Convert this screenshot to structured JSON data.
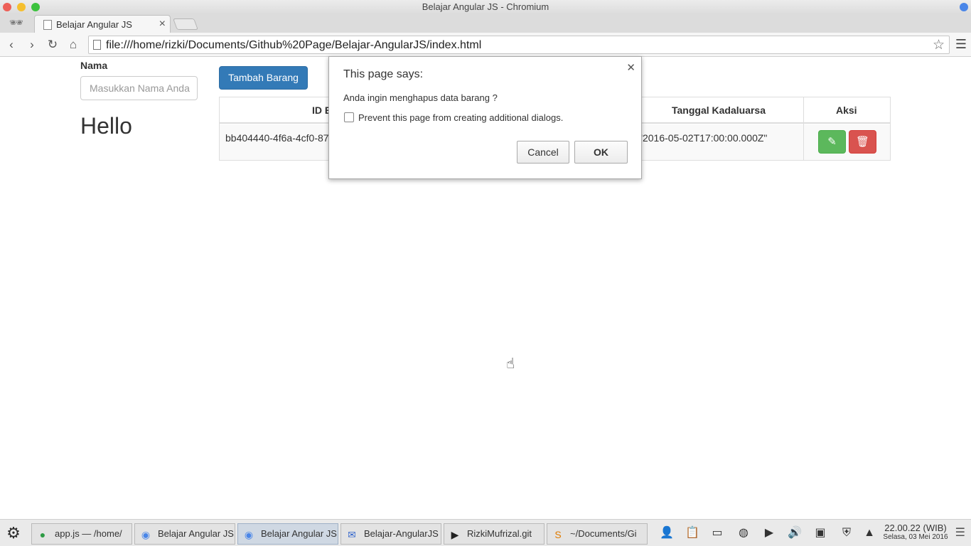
{
  "window": {
    "title": "Belajar Angular JS - Chromium"
  },
  "browser": {
    "tab_title": "Belajar Angular JS",
    "url": "file:///home/rizki/Documents/Github%20Page/Belajar-AngularJS/index.html"
  },
  "page": {
    "nama_label": "Nama",
    "nama_placeholder": "Masukkan Nama Anda",
    "hello": "Hello",
    "add_button": "Tambah Barang",
    "table": {
      "headers": [
        "ID B",
        "Tanggal Kadaluarsa",
        "Aksi"
      ],
      "rows": [
        {
          "id": "bb404440-4f6a-4cf0-87",
          "date": "\"2016-05-02T17:00:00.000Z\""
        }
      ]
    }
  },
  "dialog": {
    "title": "This page says:",
    "message": "Anda ingin menghapus data barang ?",
    "checkbox_label": "Prevent this page from creating additional dialogs.",
    "cancel": "Cancel",
    "ok": "OK"
  },
  "taskbar": {
    "tasks": [
      {
        "label": "app.js — /home/",
        "icon": "atom-icon"
      },
      {
        "label": "Belajar Angular JS",
        "icon": "chromium-icon"
      },
      {
        "label": "Belajar Angular JS",
        "icon": "chromium-icon"
      },
      {
        "label": "Belajar-AngularJS",
        "icon": "mail-icon"
      },
      {
        "label": "RizkiMufrizal.git",
        "icon": "terminal-icon"
      },
      {
        "label": "~/Documents/Gi",
        "icon": "sublime-icon"
      }
    ],
    "clock_time": "22.00.22 (WIB)",
    "clock_date": "Selasa, 03 Mei 2016"
  }
}
